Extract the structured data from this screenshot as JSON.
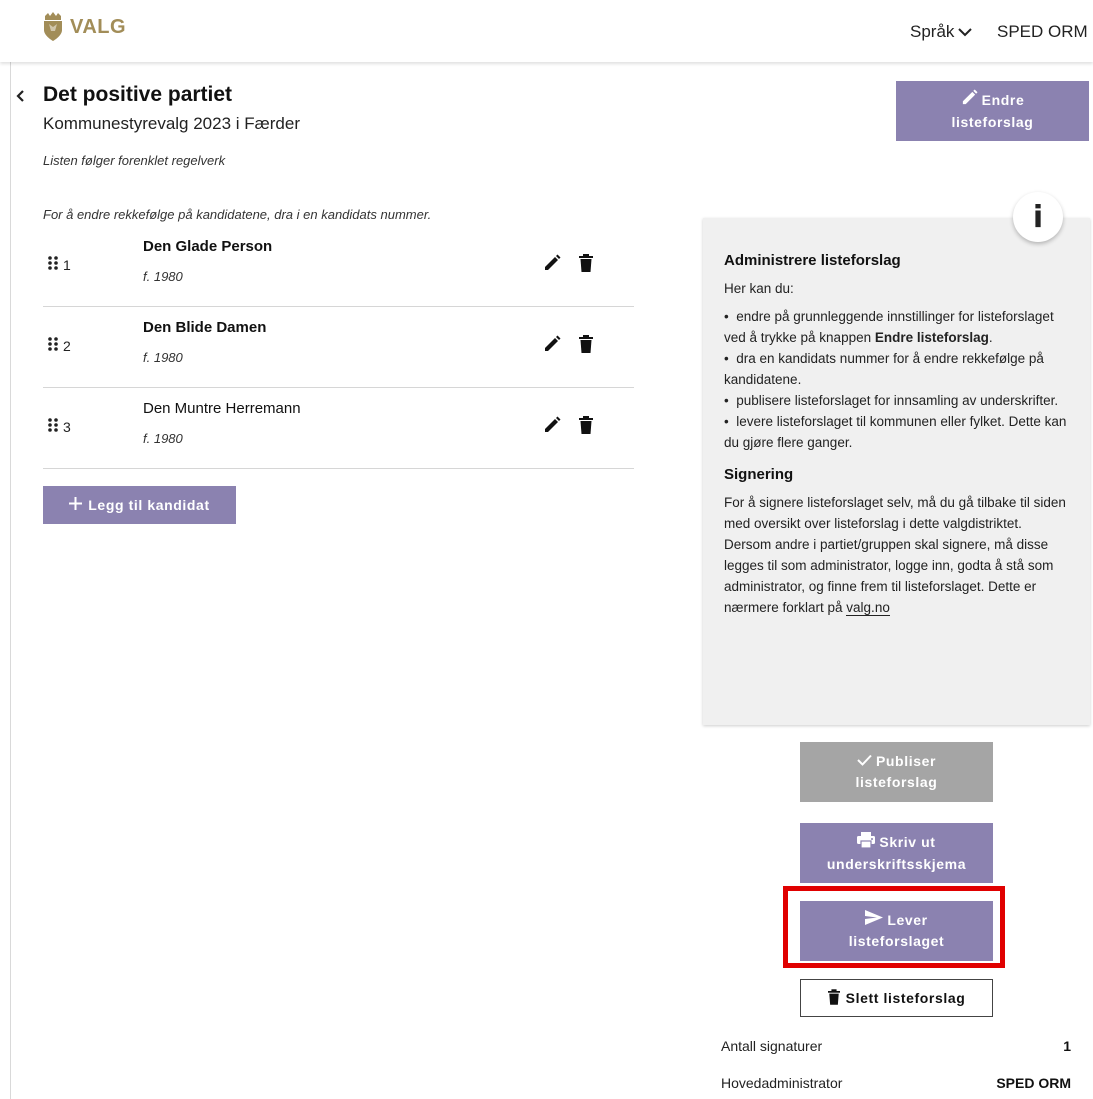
{
  "header": {
    "logo_text": "VALG",
    "language_label": "Språk",
    "user_name": "SPED ORM"
  },
  "page": {
    "title": "Det positive partiet",
    "subtitle": "Kommunestyrevalg 2023 i Færder",
    "rule_note": "Listen følger forenklet regelverk",
    "order_note": "For å endre rekkefølge på kandidatene, dra i en kandidats nummer."
  },
  "candidates": [
    {
      "number": "1",
      "name": "Den Glade Person",
      "birth": "f. 1980"
    },
    {
      "number": "2",
      "name": "Den Blide Damen",
      "birth": "f. 1980"
    },
    {
      "number": "3",
      "name": "Den Muntre Herremann",
      "birth": "f. 1980"
    }
  ],
  "buttons": {
    "add_candidate": "Legg til kandidat",
    "edit_list_line1": "Endre",
    "edit_list_line2": "listeforslag",
    "publish_line1": "Publiser",
    "publish_line2": "listeforslag",
    "print_line1": "Skriv ut",
    "print_line2": "underskriftsskjema",
    "deliver_line1": "Lever",
    "deliver_line2": "listeforslaget",
    "delete_list": "Slett listeforslag"
  },
  "info_panel": {
    "badge": "i",
    "heading": "Administrere listeforslag",
    "intro": "Her kan du:",
    "bullet1_a": "endre på grunnleggende innstillinger for listeforslaget ved å trykke på knappen ",
    "bullet1_b": "Endre listeforslag",
    "bullet1_c": ".",
    "bullet2": "dra en kandidats nummer for å endre rekkefølge på kandidatene.",
    "bullet3": "publisere listeforslaget for innsamling av underskrifter.",
    "bullet4": "levere listeforslaget til kommunen eller fylket. Dette kan du gjøre flere ganger.",
    "heading2": "Signering",
    "signing_text": "For å signere listeforslaget selv, må du gå tilbake til siden med oversikt over listeforslag i dette valgdistriktet. Dersom andre i partiet/gruppen skal signere, må disse legges til som administrator, logge inn, godta å stå som administrator, og finne frem til listeforslaget. Dette er nærmere forklart på ",
    "link": "valg.no"
  },
  "meta": {
    "signatures_label": "Antall signaturer",
    "signatures_value": "1",
    "admin_label": "Hovedadministrator",
    "admin_value": "SPED ORM"
  },
  "colors": {
    "primary_purple": "#8b82b0",
    "disabled_gray": "#a5a5a5",
    "highlight_red": "#e00000",
    "logo_gold": "#a28d58",
    "panel_bg": "#f0f0f0"
  },
  "icons": [
    "valg-crest-icon",
    "chevron-down-icon",
    "back-chevron-icon",
    "drag-handle-icon",
    "pencil-icon",
    "trash-icon",
    "plus-icon",
    "check-icon",
    "printer-icon",
    "send-icon",
    "info-icon"
  ]
}
